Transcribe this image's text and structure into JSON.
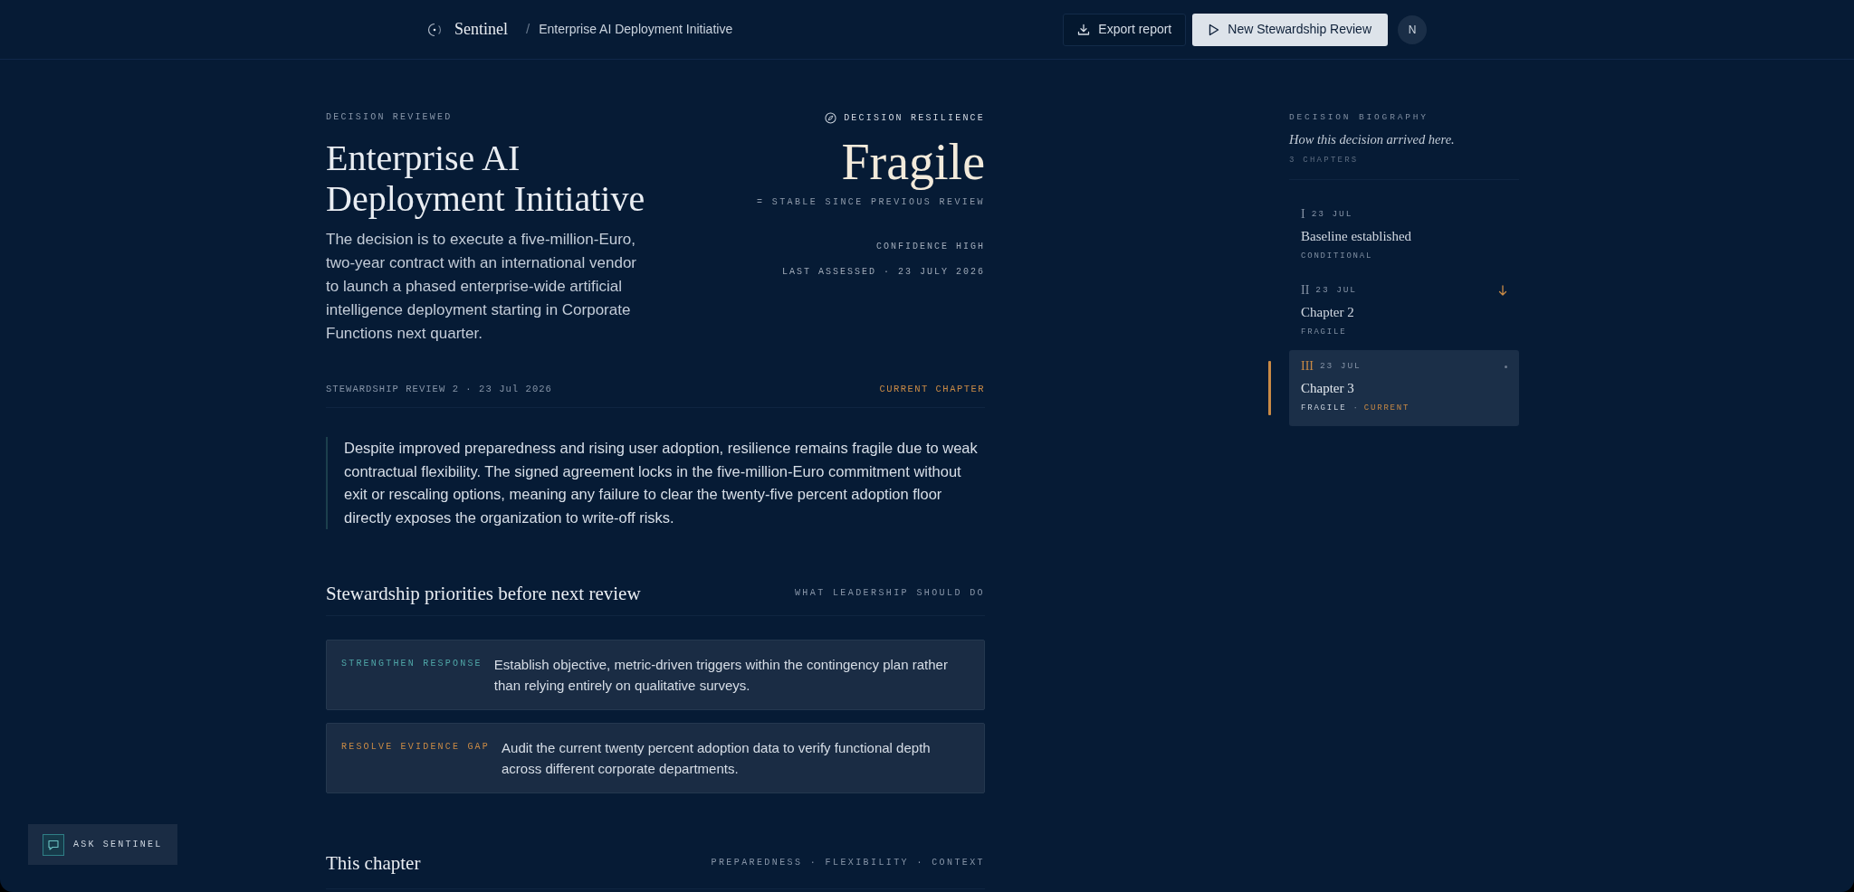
{
  "topbar": {
    "brand": "Sentinel",
    "separator": "/",
    "breadcrumb": "Enterprise AI Deployment Initiative",
    "buttons": [
      {
        "label": "Export report",
        "kind": "secondary"
      },
      {
        "label": "New Stewardship Review",
        "kind": "primary"
      }
    ],
    "avatar": "N"
  },
  "decision": {
    "eyebrow": "DECISION REVIEWED",
    "title": "Enterprise AI Deployment Initiative",
    "summary": "The decision is to execute a five-million-Euro, two-year contract with an international vendor to launch a phased enterprise-wide artificial intelligence deployment starting in Corporate Functions next quarter."
  },
  "resilience": {
    "eyebrow": "DECISION RESILIENCE",
    "rating": "Fragile",
    "trend": "= STABLE SINCE PREVIOUS REVIEW",
    "confidence": "CONFIDENCE HIGH",
    "last_assessed": "LAST ASSESSED · 23 JULY 2026"
  },
  "review": {
    "label": "STEWARDSHIP REVIEW 2 · 23 Jul 2026",
    "chapter_label": "CURRENT CHAPTER",
    "quote": "Despite improved preparedness and rising user adoption, resilience remains fragile due to weak contractual flexibility. The signed agreement locks in the five-million-Euro commitment without exit or rescaling options, meaning any failure to clear the twenty-five percent adoption floor directly exposes the organization to write-off risks."
  },
  "priorities": {
    "title": "Stewardship priorities before next review",
    "subtitle": "WHAT LEADERSHIP SHOULD DO",
    "items": [
      {
        "tag": "STRENGTHEN RESPONSE",
        "color": "#4fa6a7",
        "text": "Establish objective, metric-driven triggers within the contingency plan rather than relying entirely on qualitative surveys."
      },
      {
        "tag": "RESOLVE EVIDENCE GAP",
        "color": "#c98a45",
        "text": "Audit the current twenty percent adoption data to verify functional depth across different corporate departments."
      }
    ]
  },
  "chapter_section": {
    "title": "This chapter",
    "subtitle": "PREPAREDNESS · FLEXIBILITY · CONTEXT"
  },
  "biography": {
    "eyebrow": "DECISION BIOGRAPHY",
    "tagline": "How this decision arrived here.",
    "count": "3 CHAPTERS",
    "chapters": [
      {
        "kind": "baseline",
        "numeral": "I",
        "date": "23 JUL",
        "title": "Baseline established",
        "status": "CONDITIONAL",
        "selected": false
      },
      {
        "kind": "declined",
        "numeral": "II",
        "date": "23 JUL",
        "title": "Chapter 2",
        "status": "FRAGILE",
        "selected": false
      },
      {
        "kind": "steady",
        "numeral": "III",
        "date": "23 JUL",
        "title": "Chapter 3",
        "status": "FRAGILE",
        "separator": "·",
        "tag": "CURRENT",
        "selected": true
      }
    ]
  },
  "assistant": {
    "label": "ASK SENTINEL"
  }
}
